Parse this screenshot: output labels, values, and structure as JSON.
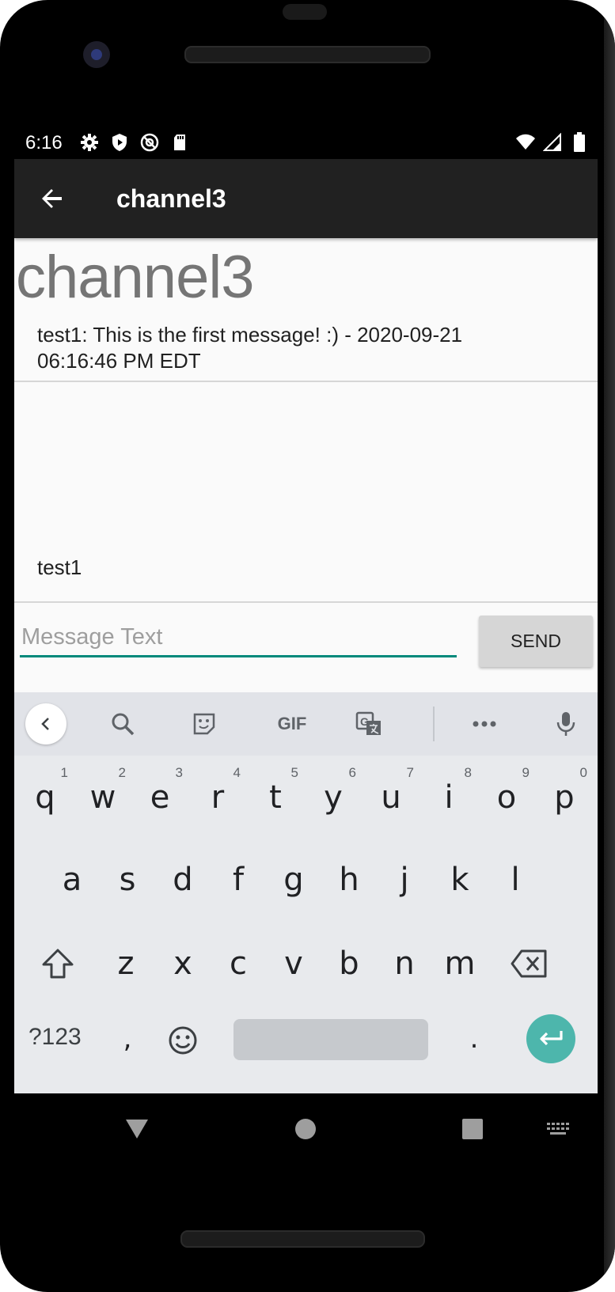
{
  "status_bar": {
    "time": "6:16",
    "left_icons": [
      "gear-icon",
      "shield-play-icon",
      "at-sign-icon",
      "sd-card-icon"
    ],
    "right_icons": [
      "wifi-icon",
      "signal-icon",
      "battery-icon"
    ]
  },
  "app_bar": {
    "back_icon": "arrow-left-icon",
    "title": "channel3"
  },
  "main": {
    "channel_heading": "channel3",
    "messages": [
      {
        "line1": "test1: This is the first message! :) - 2020-09-21",
        "line2": "06:16:46 PM EDT"
      }
    ],
    "username": "test1"
  },
  "composer": {
    "placeholder": "Message Text",
    "value": "",
    "send_label": "SEND",
    "accent_color": "#00897b"
  },
  "keyboard": {
    "suggestions": [
      "chevron-left-icon",
      "search-icon",
      "sticker-icon",
      "GIF",
      "translate-icon",
      "more-icon",
      "mic-icon"
    ],
    "row1": [
      {
        "k": "q",
        "n": "1"
      },
      {
        "k": "w",
        "n": "2"
      },
      {
        "k": "e",
        "n": "3"
      },
      {
        "k": "r",
        "n": "4"
      },
      {
        "k": "t",
        "n": "5"
      },
      {
        "k": "y",
        "n": "6"
      },
      {
        "k": "u",
        "n": "7"
      },
      {
        "k": "i",
        "n": "8"
      },
      {
        "k": "o",
        "n": "9"
      },
      {
        "k": "p",
        "n": "0"
      }
    ],
    "row2": [
      "a",
      "s",
      "d",
      "f",
      "g",
      "h",
      "j",
      "k",
      "l"
    ],
    "row3": [
      "z",
      "x",
      "c",
      "v",
      "b",
      "n",
      "m"
    ],
    "symbols_label": "?123",
    "comma": ",",
    "period": ".",
    "enter_color": "#4db6ac"
  },
  "nav_bar": {
    "buttons": [
      "back-triangle-icon",
      "home-circle-icon",
      "recents-square-icon",
      "keyboard-switch-icon"
    ]
  }
}
